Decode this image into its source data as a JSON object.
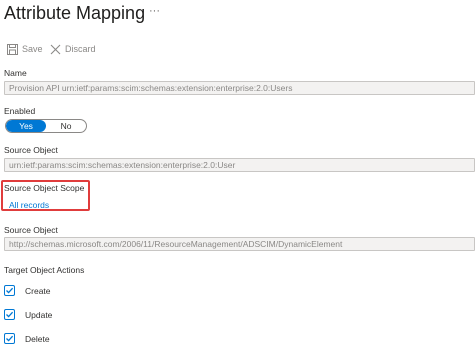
{
  "header": {
    "title": "Attribute Mapping",
    "more_label": "···"
  },
  "toolbar": {
    "save_label": "Save",
    "discard_label": "Discard"
  },
  "name": {
    "label": "Name",
    "value": "Provision API urn:ietf:params:scim:schemas:extension:enterprise:2.0:Users"
  },
  "enabled": {
    "label": "Enabled",
    "yes_label": "Yes",
    "no_label": "No",
    "selected": "Yes"
  },
  "source_object": {
    "label": "Source Object",
    "value": "urn:ietf:params:scim:schemas:extension:enterprise:2.0:User"
  },
  "source_object_scope": {
    "label": "Source Object Scope",
    "link_text": "All records"
  },
  "target_object": {
    "label": "Source Object",
    "value": "http://schemas.microsoft.com/2006/11/ResourceManagement/ADSCIM/DynamicElement"
  },
  "target_object_actions": {
    "label": "Target Object Actions",
    "items": [
      {
        "label": "Create",
        "checked": true
      },
      {
        "label": "Update",
        "checked": true
      },
      {
        "label": "Delete",
        "checked": true
      }
    ]
  },
  "colors": {
    "accent": "#0078d4",
    "highlight_border": "#e03c3c",
    "disabled_text": "#8a8886",
    "field_bg": "#f3f2f1"
  }
}
